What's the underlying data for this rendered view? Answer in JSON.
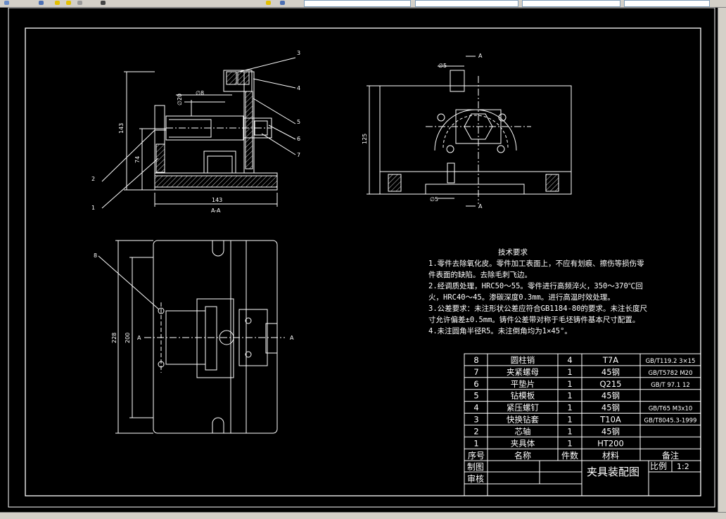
{
  "colors": {
    "background": "#000000",
    "lines": "#ffffff",
    "chrome": "#d4d0c8"
  },
  "section_view": {
    "label": "A-A",
    "dims": {
      "height_total": "143",
      "height_mid": "74",
      "width": "143",
      "bore_dia": "∅20",
      "pin_dia": "∅8"
    },
    "balloons": [
      "1",
      "2",
      "3",
      "4",
      "5",
      "6",
      "7"
    ]
  },
  "side_view": {
    "dims": {
      "height": "125",
      "top_hole": "∅5",
      "bottom_hole": "∅5"
    },
    "cut_labels": [
      "A",
      "A"
    ]
  },
  "top_view": {
    "dims": {
      "outer_h": "228",
      "inner_h": "200"
    },
    "cut_labels": [
      "A",
      "A"
    ],
    "balloon": "8"
  },
  "notes": {
    "title": "技术要求",
    "lines": [
      "1.零件去除氧化皮。零件加工表面上，不应有划痕、擦伤等损伤零",
      "件表面的缺陷。去除毛刺飞边。",
      "2.经调质处理，HRC50～55。零件进行高频淬火，350～370℃回",
      "火，HRC40～45。渗碳深度0.3mm。进行高温时效处理。",
      "3.公差要求：未注形状公差应符合GB1184-80的要求。未注长度尺",
      "寸允许偏差±0.5mm。铸件公差带对称于毛坯铸件基本尺寸配置。",
      "4.未注圆角半径R5。未注倒角均为1×45°。"
    ]
  },
  "bom": {
    "headers": [
      "序号",
      "名称",
      "件数",
      "材料",
      "备注"
    ],
    "rows": [
      [
        "8",
        "圆柱销",
        "4",
        "T7A",
        "GB/T119.2 3×15"
      ],
      [
        "7",
        "夹紧螺母",
        "1",
        "45钢",
        "GB/T5782 M20"
      ],
      [
        "6",
        "平垫片",
        "1",
        "Q215",
        "GB/T 97.1  12"
      ],
      [
        "5",
        "钻模板",
        "1",
        "45钢",
        ""
      ],
      [
        "4",
        "紧压螺钉",
        "1",
        "45钢",
        "GB/T65 M3x10"
      ],
      [
        "3",
        "快换钻套",
        "1",
        "T10A",
        "GB/T8045.3-1999"
      ],
      [
        "2",
        "芯轴",
        "1",
        "45钢",
        ""
      ],
      [
        "1",
        "夹具体",
        "1",
        "HT200",
        ""
      ]
    ]
  },
  "title_block": {
    "drawn_label": "制图",
    "check_label": "审核",
    "title": "夹具装配图",
    "scale_label": "比例",
    "scale_value": "1:2"
  }
}
